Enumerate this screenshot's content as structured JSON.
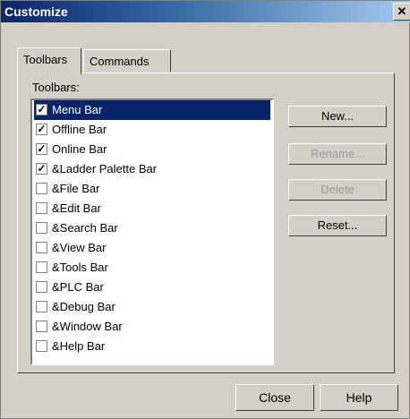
{
  "window": {
    "title": "Customize",
    "close_glyph": "✕"
  },
  "tabs": [
    {
      "label": "Toolbars",
      "active": true
    },
    {
      "label": "Commands",
      "active": false
    }
  ],
  "toolbars_panel": {
    "label": "Toolbars:",
    "items": [
      {
        "label": "Menu Bar",
        "checked": true,
        "selected": true
      },
      {
        "label": "Offline Bar",
        "checked": true,
        "selected": false
      },
      {
        "label": "Online Bar",
        "checked": true,
        "selected": false
      },
      {
        "label": "&Ladder Palette Bar",
        "checked": true,
        "selected": false
      },
      {
        "label": "&File Bar",
        "checked": false,
        "selected": false
      },
      {
        "label": "&Edit Bar",
        "checked": false,
        "selected": false
      },
      {
        "label": "&Search Bar",
        "checked": false,
        "selected": false
      },
      {
        "label": "&View Bar",
        "checked": false,
        "selected": false
      },
      {
        "label": "&Tools Bar",
        "checked": false,
        "selected": false
      },
      {
        "label": "&PLC Bar",
        "checked": false,
        "selected": false
      },
      {
        "label": "&Debug Bar",
        "checked": false,
        "selected": false
      },
      {
        "label": "&Window Bar",
        "checked": false,
        "selected": false
      },
      {
        "label": "&Help Bar",
        "checked": false,
        "selected": false
      }
    ],
    "buttons": {
      "new": "New...",
      "rename": "Rename...",
      "delete": "Delete",
      "reset": "Reset..."
    }
  },
  "footer": {
    "close": "Close",
    "help": "Help"
  },
  "colors": {
    "selection": "#0a246a",
    "face": "#d4d0c8",
    "disabled_text": "#9a9a9a"
  }
}
